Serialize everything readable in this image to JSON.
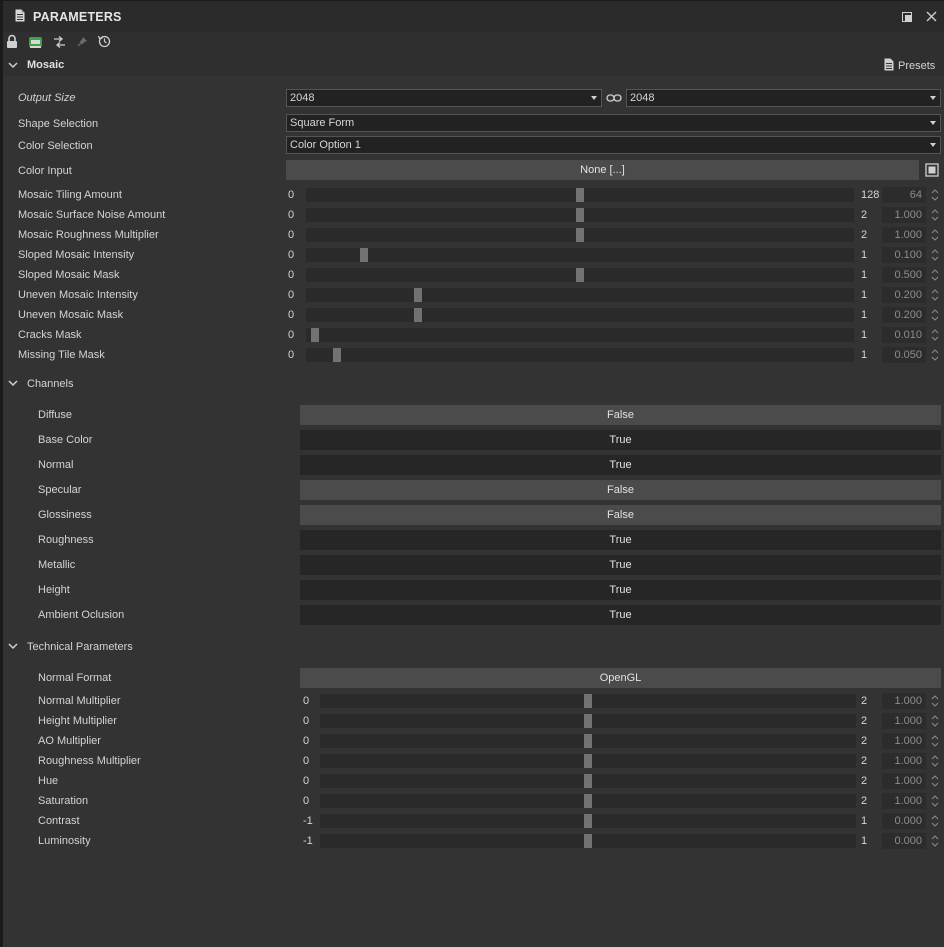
{
  "panel": {
    "title": "PARAMETERS"
  },
  "toolbar": {
    "icons": [
      "lock-icon",
      "node-icon",
      "link-toggle-icon",
      "pin-icon",
      "reset-icon"
    ]
  },
  "mosaic": {
    "section_title": "Mosaic",
    "presets_label": "Presets",
    "output_size": {
      "label": "Output Size",
      "width": "2048",
      "height": "2048"
    },
    "shape_selection": {
      "label": "Shape Selection",
      "value": "Square Form"
    },
    "color_selection": {
      "label": "Color Selection",
      "value": "Color Option 1"
    },
    "color_input": {
      "label": "Color Input",
      "value": "None [...]"
    },
    "sliders": [
      {
        "label": "Mosaic Tiling Amount",
        "min": "0",
        "max": "128",
        "value": "64",
        "fraction": 0.5
      },
      {
        "label": "Mosaic Surface Noise Amount",
        "min": "0",
        "max": "2",
        "value": "1.000",
        "fraction": 0.5
      },
      {
        "label": "Mosaic Roughness Multiplier",
        "min": "0",
        "max": "2",
        "value": "1.000",
        "fraction": 0.5
      },
      {
        "label": "Sloped Mosaic Intensity",
        "min": "0",
        "max": "1",
        "value": "0.100",
        "fraction": 0.1
      },
      {
        "label": "Sloped Mosaic Mask",
        "min": "0",
        "max": "1",
        "value": "0.500",
        "fraction": 0.5
      },
      {
        "label": "Uneven Mosaic Intensity",
        "min": "0",
        "max": "1",
        "value": "0.200",
        "fraction": 0.2
      },
      {
        "label": "Uneven Mosaic Mask",
        "min": "0",
        "max": "1",
        "value": "0.200",
        "fraction": 0.2
      },
      {
        "label": "Cracks Mask",
        "min": "0",
        "max": "1",
        "value": "0.010",
        "fraction": 0.01
      },
      {
        "label": "Missing Tile Mask",
        "min": "0",
        "max": "1",
        "value": "0.050",
        "fraction": 0.05
      }
    ]
  },
  "channels": {
    "section_title": "Channels",
    "items": [
      {
        "label": "Diffuse",
        "value": "False"
      },
      {
        "label": "Base Color",
        "value": "True"
      },
      {
        "label": "Normal",
        "value": "True"
      },
      {
        "label": "Specular",
        "value": "False"
      },
      {
        "label": "Glossiness",
        "value": "False"
      },
      {
        "label": "Roughness",
        "value": "True"
      },
      {
        "label": "Metallic",
        "value": "True"
      },
      {
        "label": "Height",
        "value": "True"
      },
      {
        "label": "Ambient Oclusion",
        "value": "True"
      }
    ]
  },
  "technical": {
    "section_title": "Technical Parameters",
    "normal_format": {
      "label": "Normal Format",
      "value": "OpenGL"
    },
    "sliders": [
      {
        "label": "Normal Multiplier",
        "min": "0",
        "max": "2",
        "value": "1.000",
        "fraction": 0.5
      },
      {
        "label": "Height Multiplier",
        "min": "0",
        "max": "2",
        "value": "1.000",
        "fraction": 0.5
      },
      {
        "label": "AO Multiplier",
        "min": "0",
        "max": "2",
        "value": "1.000",
        "fraction": 0.5
      },
      {
        "label": "Roughness Multiplier",
        "min": "0",
        "max": "2",
        "value": "1.000",
        "fraction": 0.5
      },
      {
        "label": "Hue",
        "min": "0",
        "max": "2",
        "value": "1.000",
        "fraction": 0.5
      },
      {
        "label": "Saturation",
        "min": "0",
        "max": "2",
        "value": "1.000",
        "fraction": 0.5
      },
      {
        "label": "Contrast",
        "min": "-1",
        "max": "1",
        "value": "0.000",
        "fraction": 0.5
      },
      {
        "label": "Luminosity",
        "min": "-1",
        "max": "1",
        "value": "0.000",
        "fraction": 0.5
      }
    ]
  },
  "colors": {
    "background": "#333333",
    "titlebar": "#2b2b2b",
    "false_toggle": "#4b4b4b",
    "true_toggle": "#262626",
    "slider_handle": "#727272",
    "accent_green": "#3fa34d"
  }
}
